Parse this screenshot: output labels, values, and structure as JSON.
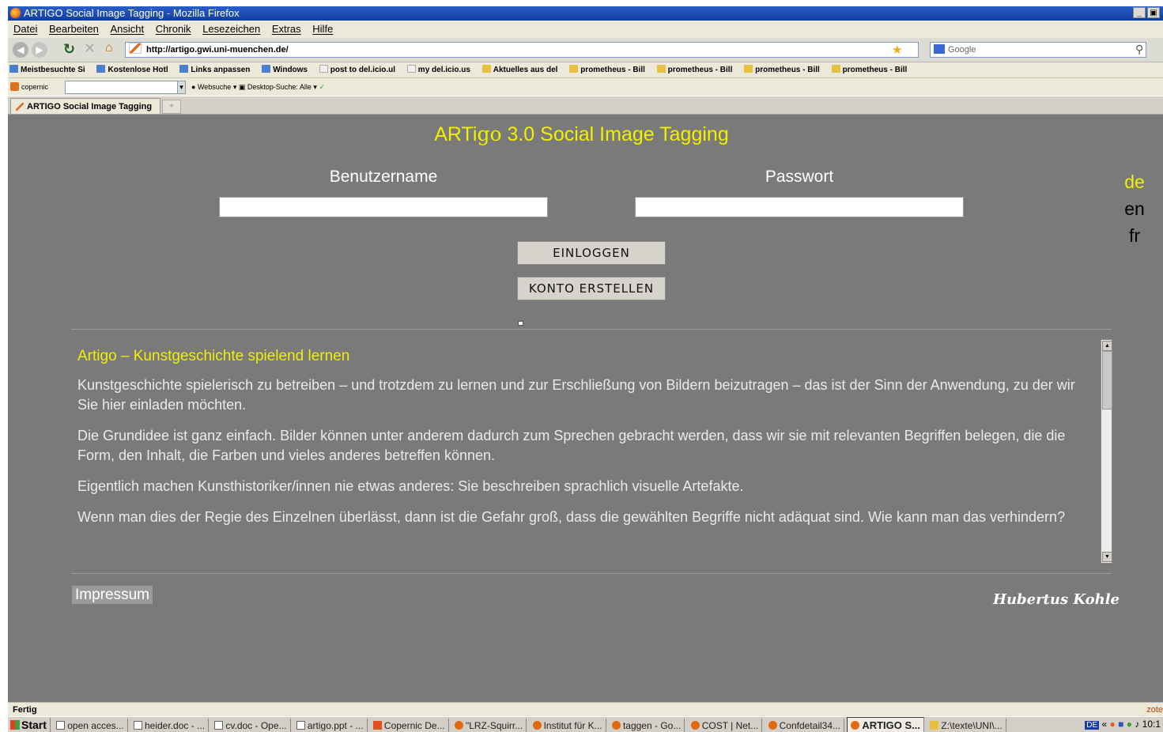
{
  "window": {
    "title": "ARTIGO Social Image Tagging - Mozilla Firefox",
    "buttons": [
      "_",
      " "
    ]
  },
  "menu": [
    "Datei",
    "Bearbeiten",
    "Ansicht",
    "Chronik",
    "Lesezeichen",
    "Extras",
    "Hilfe"
  ],
  "nav": {
    "url": "http://artigo.gwi.uni-muenchen.de/",
    "search_placeholder": "Google"
  },
  "bookmarks": [
    {
      "label": "Meistbesuchte Si",
      "icon": "feed-icon"
    },
    {
      "label": "Kostenlose Hotl",
      "icon": "msn-icon"
    },
    {
      "label": "Links anpassen",
      "icon": "msn-icon"
    },
    {
      "label": "Windows",
      "icon": "msn-icon"
    },
    {
      "label": "post to del.icio.ul",
      "icon": "page-icon"
    },
    {
      "label": "my del.icio.us",
      "icon": "page-icon"
    },
    {
      "label": "Aktuelles aus del",
      "icon": "rss-folder-icon"
    },
    {
      "label": "prometheus - Bill",
      "icon": "rss-folder-icon"
    },
    {
      "label": "prometheus - Bill",
      "icon": "rss-folder-icon"
    },
    {
      "label": "prometheus - Bill",
      "icon": "rss-folder-icon"
    },
    {
      "label": "prometheus - Bill",
      "icon": "rss-folder-icon"
    }
  ],
  "copernic": {
    "label": "copernic",
    "websuche": "Websuche",
    "desktop": "Desktop-Suche: Alle"
  },
  "tab": {
    "label": "ARTIGO Social Image Tagging"
  },
  "page": {
    "title_prefix": "ARTi",
    "title_igo": "go",
    "title_suffix": " 3.0 Social Image Tagging",
    "username_label": "Benutzername",
    "password_label": "Passwort",
    "login_button": "EINLOGGEN",
    "register_button": "KONTO ERSTELLEN",
    "languages": [
      "de",
      "en",
      "fr"
    ],
    "active_language": "de",
    "article": {
      "heading": "Artigo – Kunstgeschichte spielend lernen",
      "paragraphs": [
        "Kunstgeschichte spielerisch zu betreiben – und trotzdem zu lernen und zur Erschließung von Bildern beizutragen – das ist der Sinn der Anwendung, zu der wir Sie hier einladen möchten.",
        "Die Grundidee ist ganz einfach. Bilder können unter anderem dadurch zum Sprechen gebracht werden, dass wir sie mit relevanten Begriffen belegen, die die Form, den Inhalt, die Farben und vieles anderes betreffen können.",
        "Eigentlich machen Kunsthistoriker/innen nie etwas anderes: Sie beschreiben sprachlich visuelle Artefakte.",
        "Wenn man dies der Regie des Einzelnen überlässt, dann ist die Gefahr groß, dass die gewählten Begriffe nicht adäquat sind. Wie kann man das verhindern?"
      ]
    },
    "impressum": "Impressum",
    "author": "Hubertus Kohle"
  },
  "status": {
    "text": "Fertig",
    "right": "zote"
  },
  "taskbar": {
    "start": "Start",
    "items": [
      {
        "label": "open acces...",
        "icon": "document-icon"
      },
      {
        "label": "heider.doc - ...",
        "icon": "document-icon"
      },
      {
        "label": "cv.doc - Ope...",
        "icon": "document-icon"
      },
      {
        "label": "artigo.ppt - ...",
        "icon": "document-icon"
      },
      {
        "label": "Copernic De...",
        "icon": "copernic-icon"
      },
      {
        "label": "\"LRZ-Squirr...",
        "icon": "firefox-icon"
      },
      {
        "label": "Institut für K...",
        "icon": "firefox-icon"
      },
      {
        "label": "taggen - Go...",
        "icon": "firefox-icon"
      },
      {
        "label": "COST | Net...",
        "icon": "firefox-icon"
      },
      {
        "label": "Confdetail34...",
        "icon": "firefox-icon"
      },
      {
        "label": "ARTIGO S...",
        "icon": "firefox-icon",
        "active": true
      },
      {
        "label": "Z:\\texte\\UNI\\...",
        "icon": "folder-icon"
      }
    ],
    "lang": "DE",
    "clock": "10:1"
  },
  "colors": {
    "content_bg": "#7a7a7a",
    "accent_yellow": "#f0f000"
  }
}
